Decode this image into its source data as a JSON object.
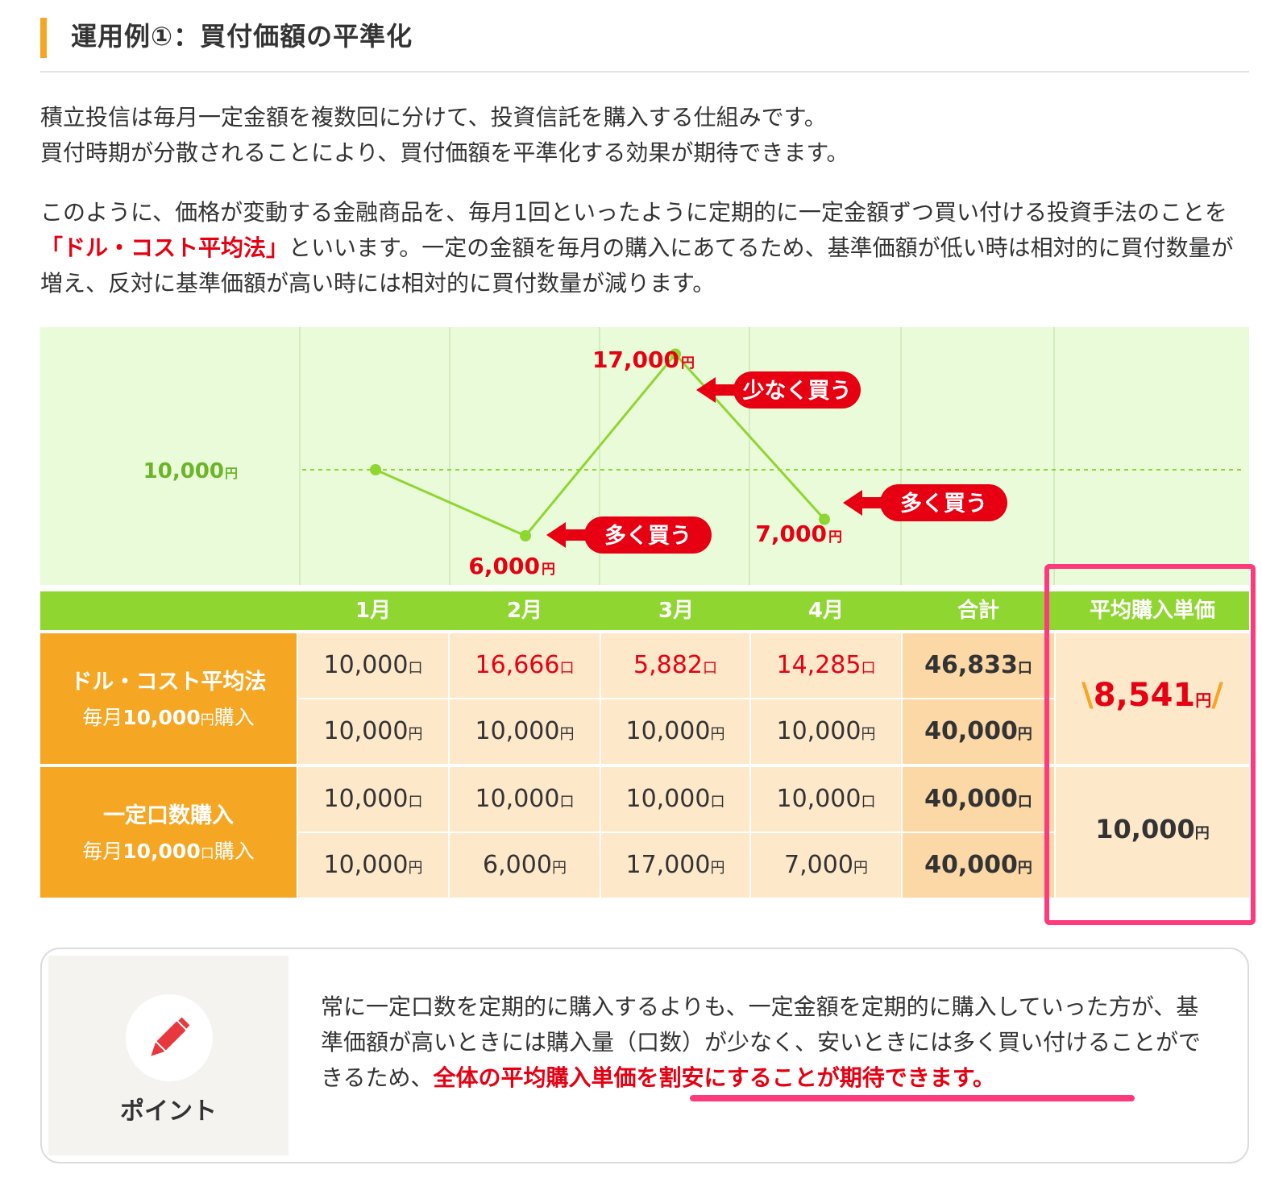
{
  "heading": {
    "title": "運用例①：買付価額の平準化"
  },
  "intro": {
    "line1": "積立投信は毎月一定金額を複数回に分けて、投資信託を購入する仕組みです。",
    "line2": "買付時期が分散されることにより、買付価額を平準化する効果が期待できます。"
  },
  "explain": {
    "before": "このように、価格が変動する金融商品を、毎月1回といったように定期的に一定金額ずつ買い付ける投資手法のことを",
    "highlight": "「ドル・コスト平均法」",
    "after": "といいます。一定の金額を毎月の購入にあてるため、基準価額が低い時は相対的に買付数量が増え、反対に基準価額が高い時には相対的に買付数量が減ります。"
  },
  "chart_data": {
    "type": "line",
    "categories": [
      "1月",
      "2月",
      "3月",
      "4月"
    ],
    "values": [
      10000,
      6000,
      17000,
      7000
    ],
    "reference_line": {
      "value": 10000,
      "label": "10,000",
      "unit": "円"
    },
    "point_labels": [
      {
        "value": "6,000",
        "unit": "円"
      },
      {
        "value": "17,000",
        "unit": "円"
      },
      {
        "value": "7,000",
        "unit": "円"
      }
    ],
    "callouts": [
      {
        "text": "多く買う",
        "month": "2月"
      },
      {
        "text": "少なく買う",
        "month": "3月"
      },
      {
        "text": "多く買う",
        "month": "4月"
      }
    ],
    "colors": {
      "line": "#8fd631",
      "callout": "#e60012",
      "background": "#eafbd9"
    }
  },
  "table": {
    "headers": [
      "1月",
      "2月",
      "3月",
      "4月",
      "合計",
      "平均購入単価"
    ],
    "groups": [
      {
        "label": "ドル・コスト平均法",
        "sub_prefix": "毎月",
        "sub_num": "10,000",
        "sub_unit": "円",
        "sub_suffix": "購入",
        "rows": [
          {
            "cells": [
              "10,000",
              "16,666",
              "5,882",
              "14,285"
            ],
            "total": "46,833",
            "unit": "口"
          },
          {
            "cells": [
              "10,000",
              "10,000",
              "10,000",
              "10,000"
            ],
            "total": "40,000",
            "unit": "円"
          }
        ],
        "avg": {
          "value": "8,541",
          "unit": "円"
        }
      },
      {
        "label": "一定口数購入",
        "sub_prefix": "毎月",
        "sub_num": "10,000",
        "sub_unit": "口",
        "sub_suffix": "購入",
        "rows": [
          {
            "cells": [
              "10,000",
              "10,000",
              "10,000",
              "10,000"
            ],
            "total": "40,000",
            "unit": "口"
          },
          {
            "cells": [
              "10,000",
              "6,000",
              "17,000",
              "7,000"
            ],
            "total": "40,000",
            "unit": "円"
          }
        ],
        "avg": {
          "value": "10,000",
          "unit": "円"
        }
      }
    ]
  },
  "point": {
    "label": "ポイント",
    "icon": "pencil-icon",
    "text": "常に一定口数を定期的に購入するよりも、一定金額を定期的に購入していった方が、基準価額が高いときには購入量（口数）が少なく、安いときには多く買い付けることができるため、",
    "highlight": "全体の平均購入単価を割安にすることが期待できます。"
  }
}
